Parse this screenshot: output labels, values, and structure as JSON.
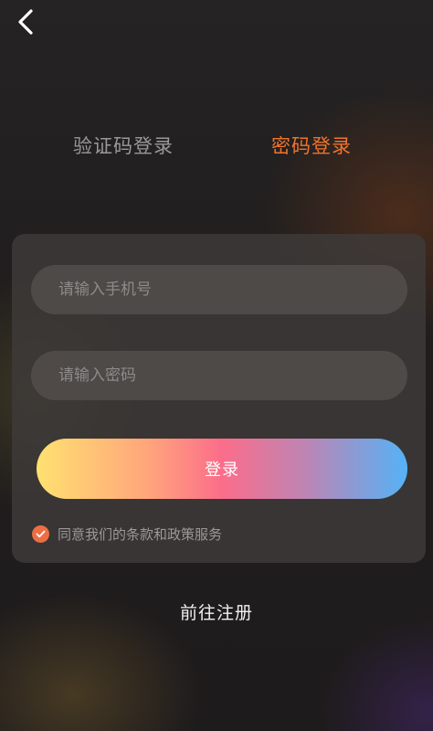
{
  "header": {
    "back_icon": "chevron-left-icon"
  },
  "tabs": [
    {
      "label": "验证码登录",
      "active": false
    },
    {
      "label": "密码登录",
      "active": true
    }
  ],
  "form": {
    "phone_placeholder": "请输入手机号",
    "password_placeholder": "请输入密码",
    "login_label": "登录",
    "agreement_label": "同意我们的条款和政策服务",
    "agreement_checked": true
  },
  "footer": {
    "register_label": "前往注册"
  },
  "colors": {
    "accent": "#f0742d",
    "checkbox": "#ee6e44",
    "inactive_tab": "#9a9898",
    "button_gradient": [
      "#ffe170",
      "#fb6d8a",
      "#55b2f6"
    ]
  }
}
